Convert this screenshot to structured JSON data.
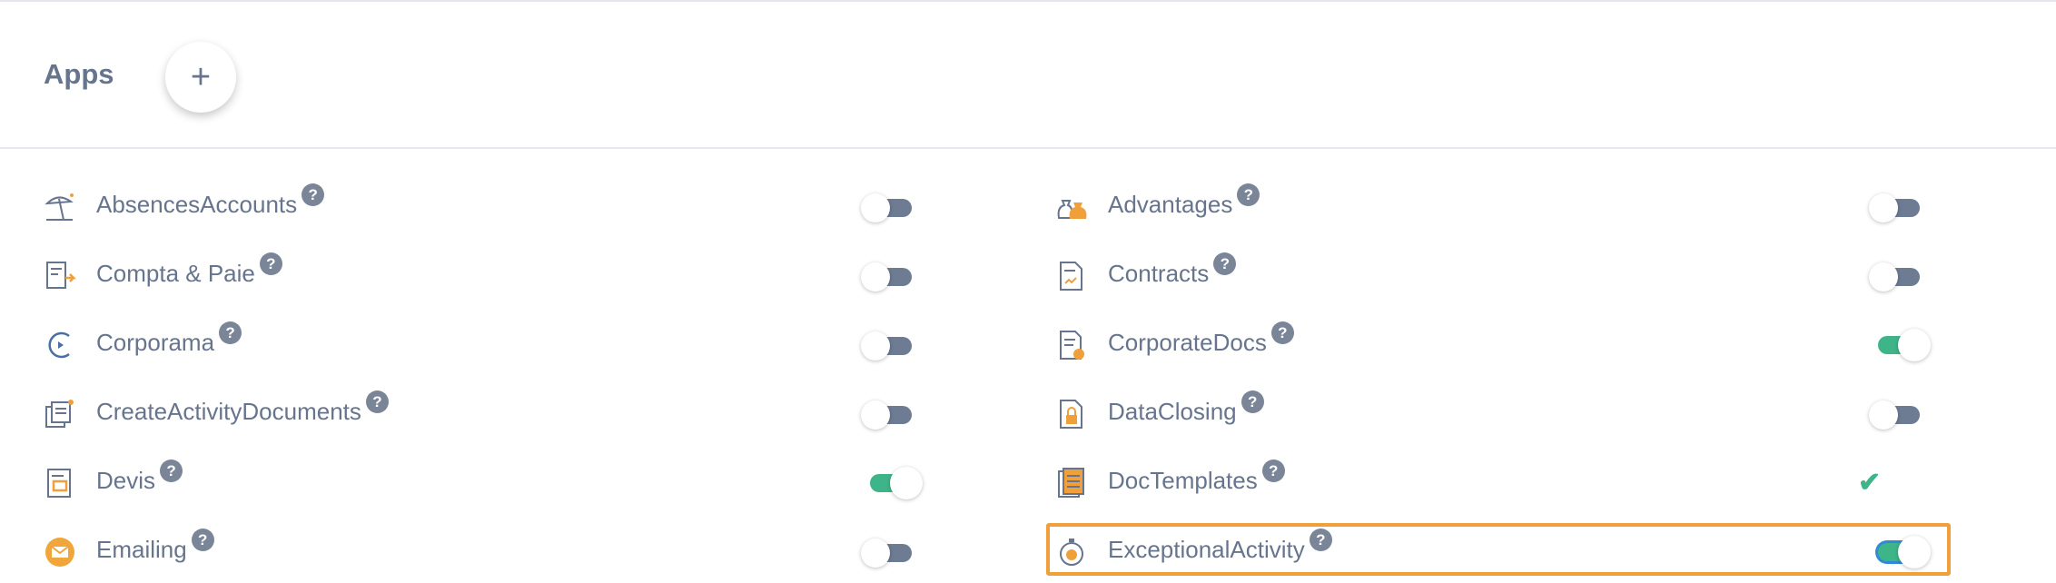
{
  "header": {
    "title": "Apps",
    "add_label": "+"
  },
  "help_glyph": "?",
  "check_glyph": "✔",
  "colors": {
    "accent_on": "#3eb489",
    "toggle_off": "#6d7b93",
    "highlight": "#f0a03a",
    "text": "#67748e"
  },
  "left_apps": [
    {
      "name": "AbsencesAccounts",
      "icon": "beach-umbrella-icon",
      "state": "off"
    },
    {
      "name": "Compta & Paie",
      "icon": "accounting-export-icon",
      "state": "off"
    },
    {
      "name": "Corporama",
      "icon": "corporama-logo-icon",
      "state": "off"
    },
    {
      "name": "CreateActivityDocuments",
      "icon": "activity-documents-icon",
      "state": "off"
    },
    {
      "name": "Devis",
      "icon": "quote-document-icon",
      "state": "on"
    },
    {
      "name": "Emailing",
      "icon": "email-icon",
      "state": "off"
    }
  ],
  "right_apps": [
    {
      "name": "Advantages",
      "icon": "money-bags-icon",
      "state": "off"
    },
    {
      "name": "Contracts",
      "icon": "contract-document-icon",
      "state": "off"
    },
    {
      "name": "CorporateDocs",
      "icon": "corporate-docs-icon",
      "state": "on"
    },
    {
      "name": "DataClosing",
      "icon": "locked-document-icon",
      "state": "off"
    },
    {
      "name": "DocTemplates",
      "icon": "doc-templates-icon",
      "state": "check"
    },
    {
      "name": "ExceptionalActivity",
      "icon": "exceptional-activity-icon",
      "state": "on"
    }
  ]
}
